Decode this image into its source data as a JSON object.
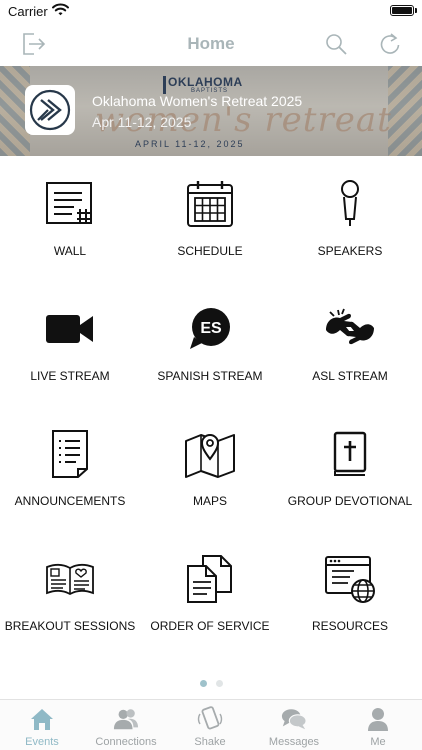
{
  "status_bar": {
    "carrier": "Carrier"
  },
  "navbar": {
    "title": "Home",
    "left_icon": "logout-icon",
    "right_icons": [
      "search-icon",
      "refresh-icon"
    ]
  },
  "event": {
    "title": "Oklahoma Women's Retreat 2025",
    "dates": "Apr 11-12, 2025",
    "banner_org": "OKLAHOMA",
    "banner_org_sub": "BAPTISTS",
    "banner_script": "women's retreat",
    "banner_date": "APRIL 11-12, 2025"
  },
  "tiles": [
    {
      "label": "WALL",
      "icon": "wall-icon"
    },
    {
      "label": "SCHEDULE",
      "icon": "calendar-icon"
    },
    {
      "label": "SPEAKERS",
      "icon": "microphone-icon"
    },
    {
      "label": "LIVE STREAM",
      "icon": "video-camera-icon"
    },
    {
      "label": "SPANISH STREAM",
      "icon": "es-speech-bubble-icon",
      "badge": "ES"
    },
    {
      "label": "ASL STREAM",
      "icon": "sign-language-icon"
    },
    {
      "label": "ANNOUNCEMENTS",
      "icon": "document-list-icon"
    },
    {
      "label": "MAPS",
      "icon": "map-pin-icon"
    },
    {
      "label": "GROUP DEVOTIONAL",
      "icon": "bible-icon"
    },
    {
      "label": "BREAKOUT SESSIONS",
      "icon": "open-book-icon"
    },
    {
      "label": "ORDER OF SERVICE",
      "icon": "documents-icon"
    },
    {
      "label": "RESOURCES",
      "icon": "web-globe-icon"
    }
  ],
  "pager": {
    "pages": 2,
    "current": 1
  },
  "tabbar": {
    "tabs": [
      {
        "label": "Events",
        "icon": "house-icon",
        "active": true
      },
      {
        "label": "Connections",
        "icon": "people-icon",
        "active": false
      },
      {
        "label": "Shake",
        "icon": "shake-phone-icon",
        "active": false
      },
      {
        "label": "Messages",
        "icon": "chat-bubbles-icon",
        "active": false
      },
      {
        "label": "Me",
        "icon": "person-icon",
        "active": false
      }
    ]
  },
  "colors": {
    "nav_title": "#a9b5b8",
    "tab_active": "#8fb9c6",
    "tab_inactive": "#9ea3a5",
    "dot_active": "#9fc2cb"
  }
}
